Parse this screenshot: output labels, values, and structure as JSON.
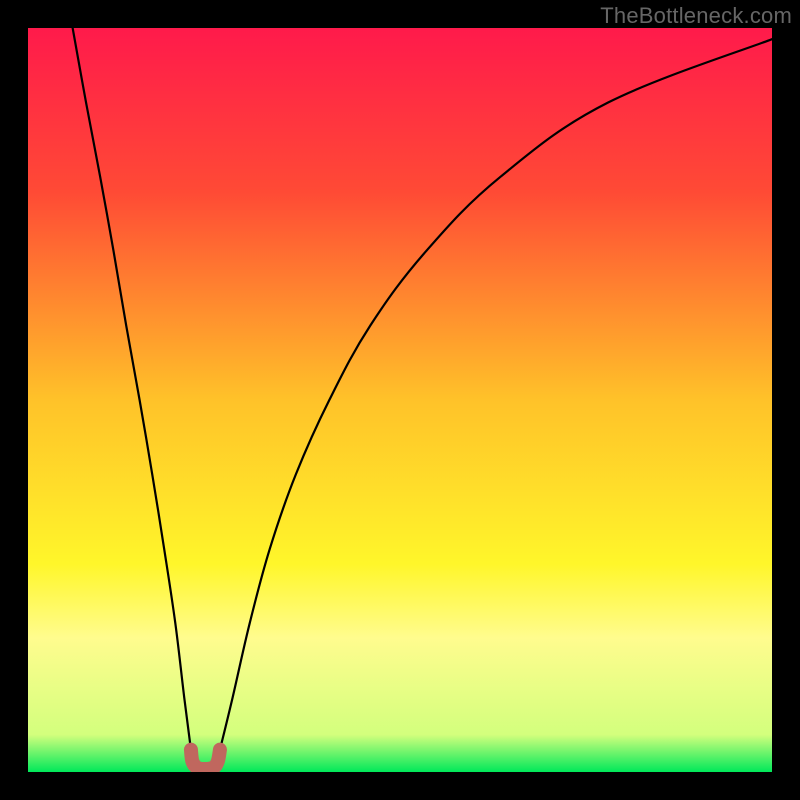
{
  "watermark": "TheBottleneck.com",
  "chart_data": {
    "type": "line",
    "title": "",
    "xlabel": "",
    "ylabel": "",
    "xlim": [
      0,
      1
    ],
    "ylim": [
      0,
      1
    ],
    "frame_color": "#000000",
    "gradient": {
      "stops": [
        {
          "offset": 0.0,
          "color": "#ff1a4b"
        },
        {
          "offset": 0.22,
          "color": "#ff4a35"
        },
        {
          "offset": 0.5,
          "color": "#ffc229"
        },
        {
          "offset": 0.72,
          "color": "#fff62a"
        },
        {
          "offset": 0.82,
          "color": "#fffc8e"
        },
        {
          "offset": 0.95,
          "color": "#d3ff7d"
        },
        {
          "offset": 1.0,
          "color": "#00e85a"
        }
      ]
    },
    "curve_left": {
      "note": "left branch descending steeply from top",
      "x": [
        0.06,
        0.078,
        0.097,
        0.115,
        0.132,
        0.15,
        0.167,
        0.183,
        0.198,
        0.21,
        0.219
      ],
      "y": [
        1.0,
        0.9,
        0.8,
        0.7,
        0.6,
        0.5,
        0.4,
        0.3,
        0.2,
        0.1,
        0.03
      ]
    },
    "curve_right": {
      "note": "right branch rising with decreasing slope",
      "x": [
        0.258,
        0.275,
        0.298,
        0.325,
        0.36,
        0.405,
        0.46,
        0.535,
        0.635,
        0.78,
        1.0
      ],
      "y": [
        0.03,
        0.1,
        0.2,
        0.3,
        0.4,
        0.5,
        0.6,
        0.7,
        0.8,
        0.9,
        0.985
      ]
    },
    "trough": {
      "note": "small U-shaped marker at the minimum of the curve",
      "color": "#c0675e",
      "stroke_width": 14,
      "x": [
        0.219,
        0.221,
        0.227,
        0.237,
        0.249,
        0.255,
        0.258
      ],
      "y": [
        0.03,
        0.014,
        0.006,
        0.004,
        0.006,
        0.014,
        0.03
      ]
    }
  }
}
